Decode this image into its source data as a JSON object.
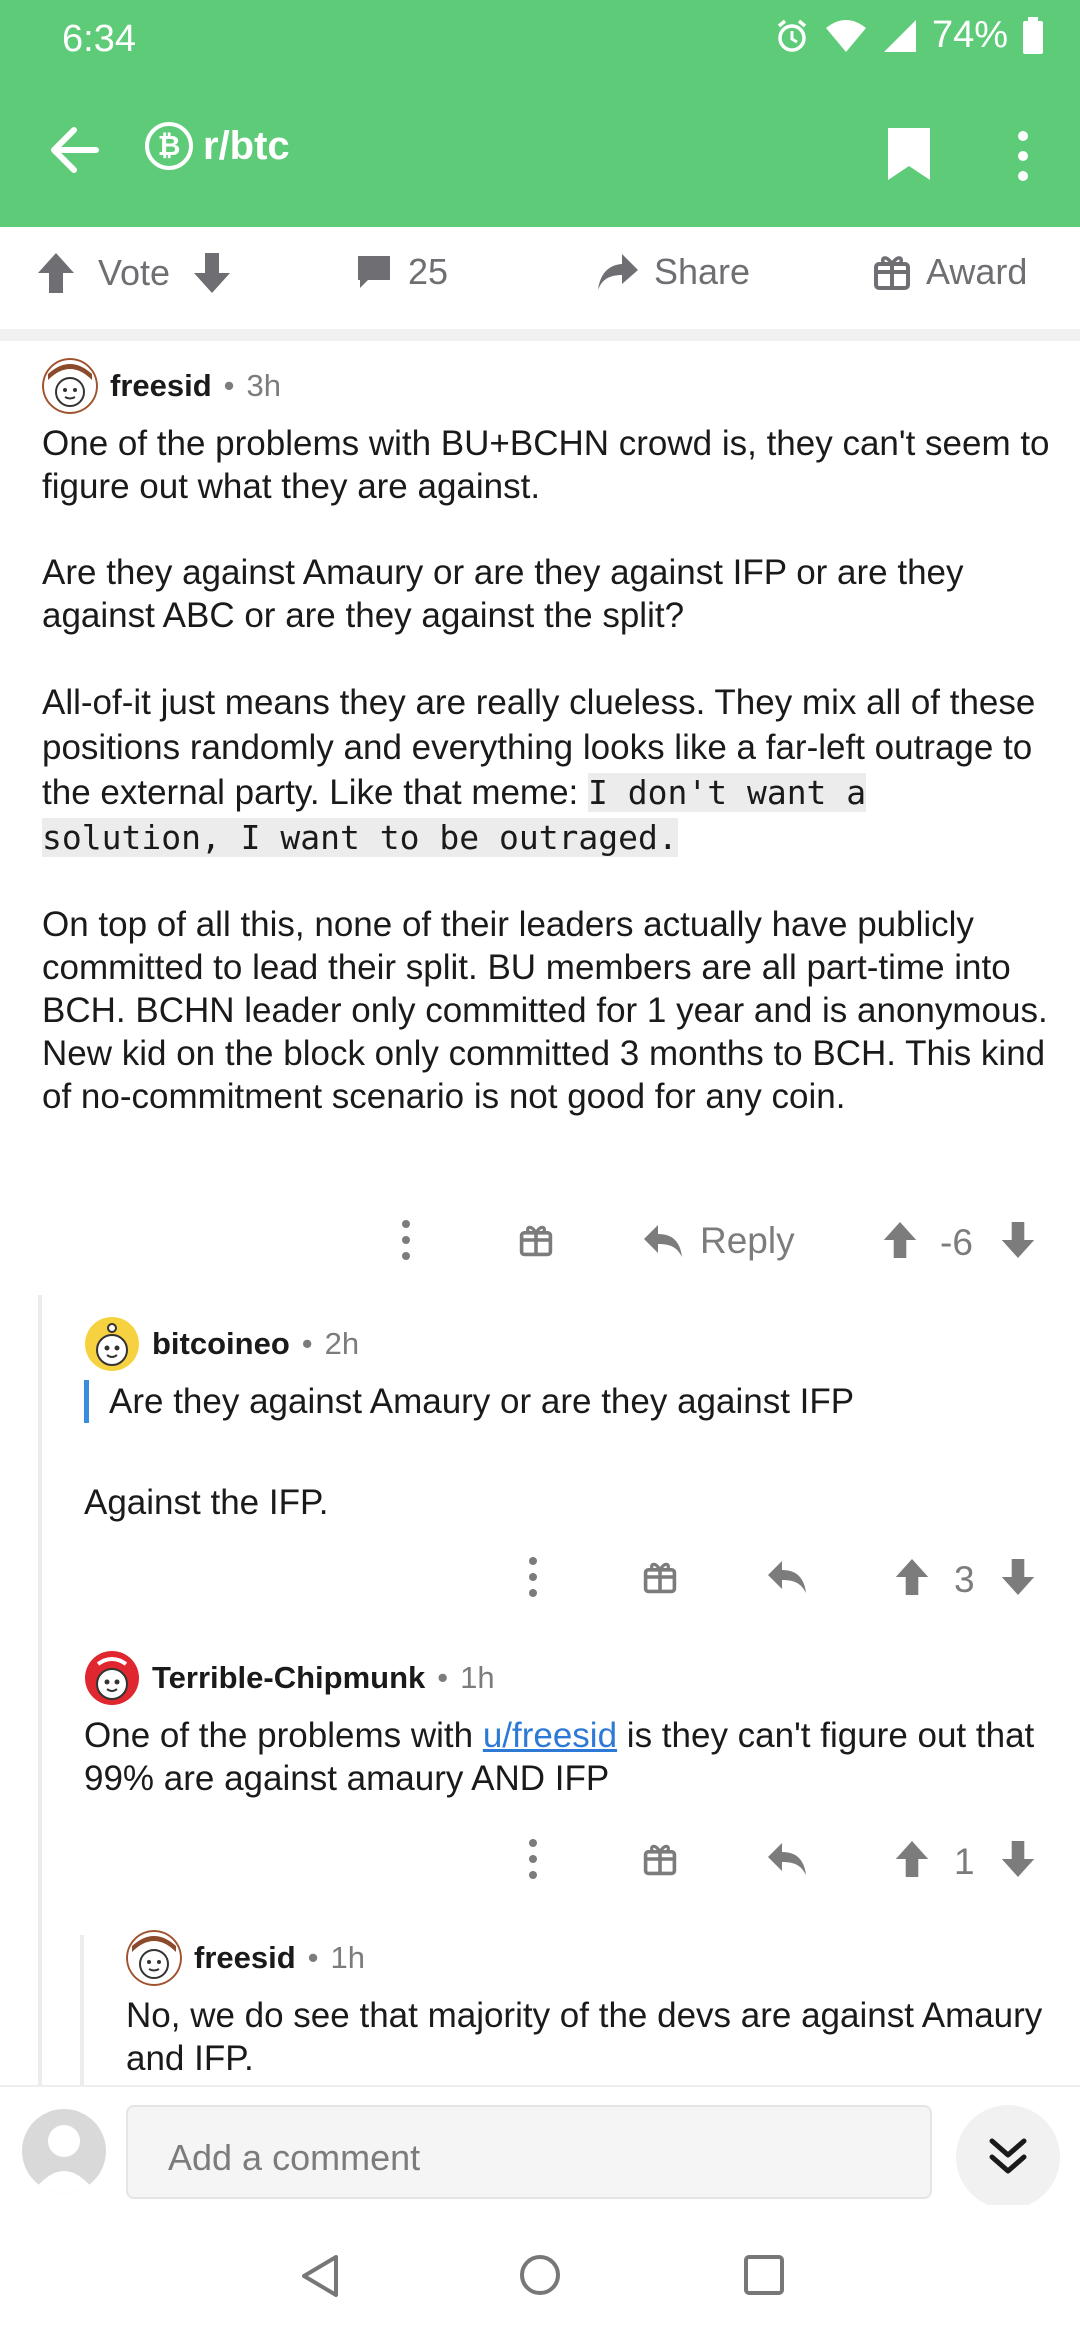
{
  "status": {
    "time": "6:34",
    "battery": "74%"
  },
  "appbar": {
    "subreddit": "r/btc",
    "sub_icon": "₿"
  },
  "actionbar": {
    "vote": "Vote",
    "comments": "25",
    "share": "Share",
    "award": "Award"
  },
  "comments": [
    {
      "user": "freesid",
      "age": "3h",
      "paragraphs": [
        "One of the problems with BU+BCHN crowd is, they can't seem to figure out what they are against.",
        "Are they against Amaury or are they against IFP or are they against ABC or are they against the split?"
      ],
      "p3_prefix": "All-of-it just means they are really clueless. They mix all of these positions randomly and everything looks like a far-left outrage to the external party.  Like that meme: ",
      "p3_code": "I don't want a solution, I want to be outraged.",
      "p4": "On top of all this, none of their leaders actually have publicly committed to lead their split. BU members are all part-time into BCH. BCHN leader only committed for 1 year and is anonymous.  New kid on the block only committed 3 months to BCH. This kind of no-commitment scenario is not good for any coin.",
      "reply": "Reply",
      "score": "-6"
    },
    {
      "user": "bitcoineo",
      "age": "2h",
      "quote": "Are they against Amaury or are they against IFP",
      "text": "Against the IFP.",
      "score": "3"
    },
    {
      "user": "Terrible-Chipmunk",
      "age": "1h",
      "prefix": "One of the problems with ",
      "link": "u/freesid",
      "suffix": " is they can't figure out that 99% are against amaury AND IFP",
      "score": "1"
    },
    {
      "user": "freesid",
      "age": "1h",
      "text": "No, we do see that majority of the devs are against Amaury and IFP."
    }
  ],
  "commentbar": {
    "placeholder": "Add a comment"
  },
  "colors": {
    "header": "#5ecb79",
    "link": "#2d7ad6",
    "quote_bar": "#3a8dde"
  }
}
